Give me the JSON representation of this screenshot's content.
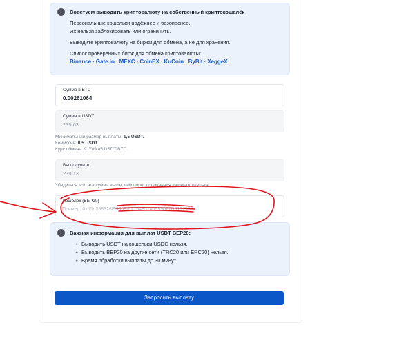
{
  "tip": {
    "title": "Советуем выводить криптовалюту на собственный криптокошелёк",
    "line1": "Персональные кошельки надёжнее и безопаснее.",
    "line2": "Их нельзя заблокировать или ограничить.",
    "line3": "Выводите криптовалюту на биржи для обмена, а не для хранения.",
    "list_title": "Список проверенных бирж для обмена криптовалюты:",
    "exchanges": [
      "Binance",
      "Gate.io",
      "MEXC",
      "CoinEX",
      "KuCoin",
      "ByBit",
      "XeggeX"
    ],
    "separator": "·",
    "icon": "info-icon"
  },
  "form": {
    "btc_label": "Сумма в BTC",
    "btc_value": "0.00261064",
    "usdt_label": "Сумма в USDT",
    "usdt_value": "239.63",
    "min_label": "Минимальный размер выплаты:",
    "min_value": "1,5 USDT.",
    "fee_label": "Комиссия:",
    "fee_value": "0.5 USDT.",
    "rate_text": "Курс обмена: 91789.05 USDT/BTC.",
    "receive_label": "Вы получите",
    "receive_value": "239.13",
    "check_note": "Убедитесь, что эта сумма выше, чем порог пополнения вашего кошелька.",
    "wallet_label": "Кошелек (BEP20)",
    "wallet_placeholder": "Пример: 0x55d398326f99059fF775485246999027B3197955",
    "wallet_value": ""
  },
  "important": {
    "title": "Важная информация для выплат USDT BEP20:",
    "items": [
      "Выводить USDT на кошельки USDC нельзя.",
      "Выводить BEP20 на другие сети (TRC20 или ERC20) нельзя.",
      "Время обработки выплаты до 30 минут."
    ],
    "icon": "info-icon"
  },
  "submit_label": "Запросить выплату",
  "colors": {
    "accent": "#0b57c8",
    "link": "#1f5bd1",
    "info_bg": "#ecf2fc",
    "annotation": "#e0141e"
  }
}
